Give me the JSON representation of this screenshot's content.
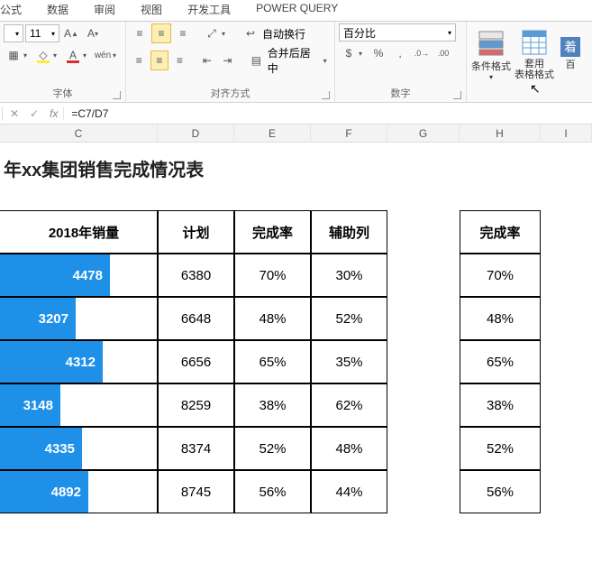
{
  "tabs": {
    "t1": "公式",
    "t2": "数据",
    "t3": "审阅",
    "t4": "视图",
    "t5": "开发工具",
    "t6": "POWER QUERY"
  },
  "font": {
    "size": "11"
  },
  "number": {
    "format": "百分比"
  },
  "align": {
    "wrap": "自动换行",
    "merge": "合并后居中"
  },
  "style": {
    "cond": "条件格式",
    "table": "套用\n表格格式"
  },
  "groups": {
    "font": "字体",
    "align": "对齐方式",
    "number": "数字"
  },
  "formula": {
    "value": "=C7/D7"
  },
  "cols": {
    "C": "C",
    "D": "D",
    "E": "E",
    "F": "F",
    "G": "G",
    "H": "H",
    "I": "I"
  },
  "title": "年xx集团销售完成情况表",
  "headers": {
    "sales": "2018年销量",
    "plan": "计划",
    "rate": "完成率",
    "aux": "辅助列",
    "rate2": "完成率"
  },
  "rows": [
    {
      "sales": "4478",
      "plan": "6380",
      "rate": "70%",
      "aux": "30%",
      "rate2": "70%",
      "barPct": 70
    },
    {
      "sales": "3207",
      "plan": "6648",
      "rate": "48%",
      "aux": "52%",
      "rate2": "48%",
      "barPct": 48
    },
    {
      "sales": "4312",
      "plan": "6656",
      "rate": "65%",
      "aux": "35%",
      "rate2": "65%",
      "barPct": 65
    },
    {
      "sales": "3148",
      "plan": "8259",
      "rate": "38%",
      "aux": "62%",
      "rate2": "38%",
      "barPct": 38
    },
    {
      "sales": "4335",
      "plan": "8374",
      "rate": "52%",
      "aux": "48%",
      "rate2": "52%",
      "barPct": 52
    },
    {
      "sales": "4892",
      "plan": "8745",
      "rate": "56%",
      "aux": "44%",
      "rate2": "56%",
      "barPct": 56
    }
  ],
  "chart_data": {
    "type": "table",
    "title": "年xx集团销售完成情况表",
    "columns": [
      "2018年销量",
      "计划",
      "完成率",
      "辅助列"
    ],
    "rows": [
      [
        4478,
        6380,
        0.7,
        0.3
      ],
      [
        3207,
        6648,
        0.48,
        0.52
      ],
      [
        4312,
        6656,
        0.65,
        0.35
      ],
      [
        3148,
        8259,
        0.38,
        0.62
      ],
      [
        4335,
        8374,
        0.52,
        0.48
      ],
      [
        4892,
        8745,
        0.56,
        0.44
      ]
    ]
  }
}
